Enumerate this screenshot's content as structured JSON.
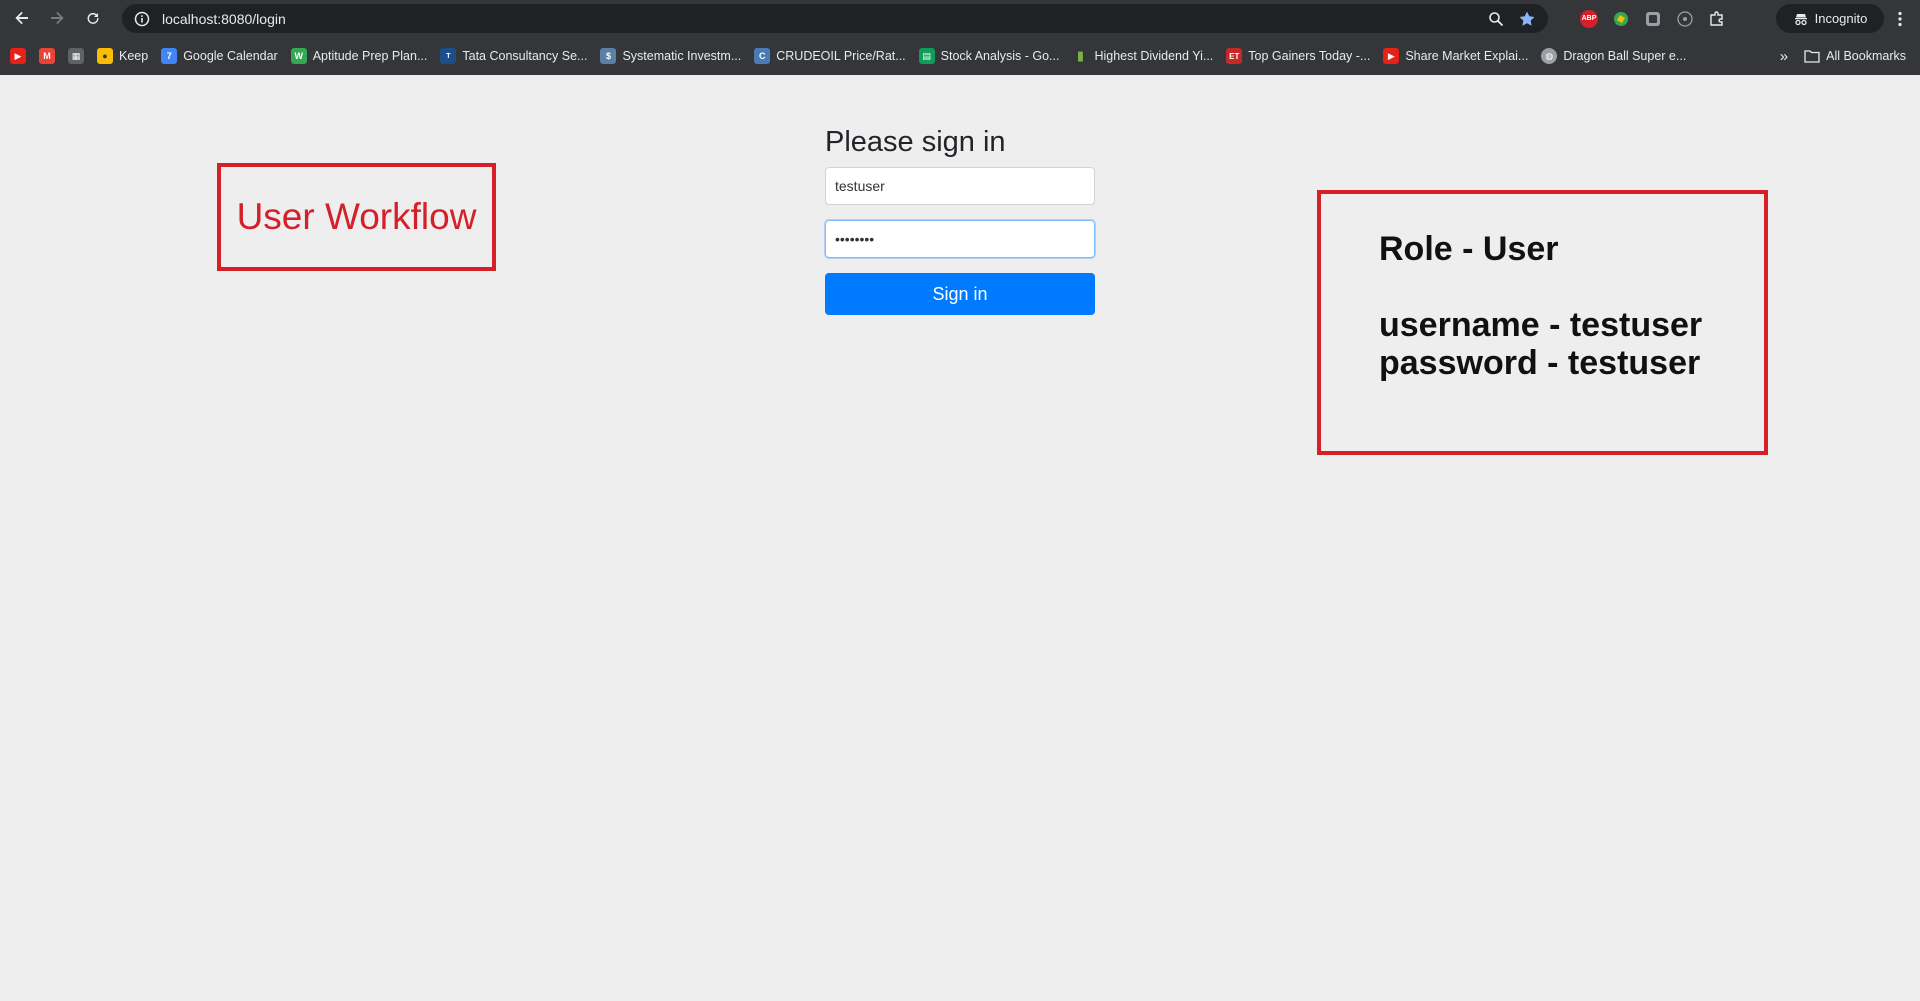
{
  "browser": {
    "url": "localhost:8080/login",
    "incognito_label": "Incognito",
    "extensions": [
      "ABP"
    ],
    "bookmarks": [
      {
        "label": "",
        "icon": "youtube-icon",
        "color": "#e62117"
      },
      {
        "label": "",
        "icon": "gmail-icon",
        "color": "#ea4335"
      },
      {
        "label": "",
        "icon": "calendar-app-icon",
        "color": "#5f6368"
      },
      {
        "label": "Keep",
        "icon": "keep-icon",
        "color": "#fbbc04"
      },
      {
        "label": "Google Calendar",
        "icon": "google-calendar-icon",
        "color": "#4285f4"
      },
      {
        "label": "Aptitude Prep Plan...",
        "icon": "aptitude-icon",
        "color": "#34a853"
      },
      {
        "label": "Tata Consultancy Se...",
        "icon": "tcs-icon",
        "color": "#1d4e89"
      },
      {
        "label": "Systematic Investm...",
        "icon": "sip-icon",
        "color": "#5b7fa6"
      },
      {
        "label": "CRUDEOIL Price/Rat...",
        "icon": "crudeoil-icon",
        "color": "#4a7bb7"
      },
      {
        "label": "Stock Analysis - Go...",
        "icon": "sheets-icon",
        "color": "#0f9d58"
      },
      {
        "label": "Highest Dividend Yi...",
        "icon": "bar-chart-icon",
        "color": "#7cb342"
      },
      {
        "label": "Top Gainers Today -...",
        "icon": "et-icon",
        "color": "#c62828"
      },
      {
        "label": "Share Market Explai...",
        "icon": "youtube-icon",
        "color": "#e62117"
      },
      {
        "label": "Dragon Ball Super e...",
        "icon": "globe-icon",
        "color": "#9aa0a6"
      }
    ],
    "all_bookmarks_label": "All Bookmarks"
  },
  "annotations": {
    "left_title": "User Workflow",
    "right_role": "Role - User",
    "right_username": "username - testuser",
    "right_password": "password - testuser"
  },
  "form": {
    "heading": "Please sign in",
    "username_value": "testuser",
    "password_value": "testuser",
    "submit_label": "Sign in"
  },
  "colors": {
    "accent": "#007bff",
    "annotation_red": "#d5202a",
    "chrome_bg": "#35363a"
  }
}
